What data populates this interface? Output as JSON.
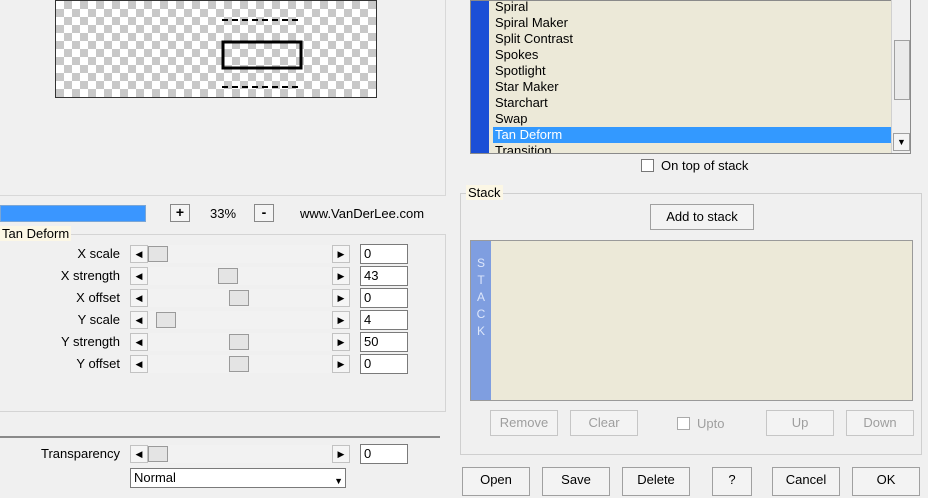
{
  "zoom": {
    "plus_label": "+",
    "value": "33%",
    "minus_label": "-",
    "progress_fraction": 1.0
  },
  "site_text": "www.VanDerLee.com",
  "filter_group_title": "Tan Deform",
  "params": [
    {
      "label": "X scale",
      "value": "0"
    },
    {
      "label": "X strength",
      "value": "43"
    },
    {
      "label": "X offset",
      "value": "0"
    },
    {
      "label": "Y scale",
      "value": "4"
    },
    {
      "label": "Y strength",
      "value": "50"
    },
    {
      "label": "Y offset",
      "value": "0"
    }
  ],
  "transparency": {
    "label": "Transparency",
    "value": "0"
  },
  "blend_mode": {
    "selected": "Normal"
  },
  "filter_list": {
    "items": [
      "Spiral",
      "Spiral Maker",
      "Split Contrast",
      "Spokes",
      "Spotlight",
      "Star Maker",
      "Starchart",
      "Swap",
      "Tan Deform",
      "Transition"
    ],
    "selected": "Tan Deform"
  },
  "on_top_of_stack": {
    "label": "On top of stack",
    "checked": false
  },
  "stack": {
    "title": "Stack",
    "add_label": "Add to stack",
    "strip_letters": [
      "S",
      "T",
      "A",
      "C",
      "K"
    ],
    "remove_label": "Remove",
    "clear_label": "Clear",
    "upto_label": "Upto",
    "up_label": "Up",
    "down_label": "Down"
  },
  "bottom_buttons": {
    "open": "Open",
    "save": "Save",
    "delete": "Delete",
    "help": "?",
    "cancel": "Cancel",
    "ok": "OK"
  },
  "icons": {
    "arrow_left": "◀",
    "arrow_right": "▶",
    "arrow_down": "▼"
  },
  "colors": {
    "selection": "#3399ff",
    "list_side": "#1b4fd6",
    "stack_strip": "#7f9ee0",
    "progress": "#3a96ff"
  }
}
